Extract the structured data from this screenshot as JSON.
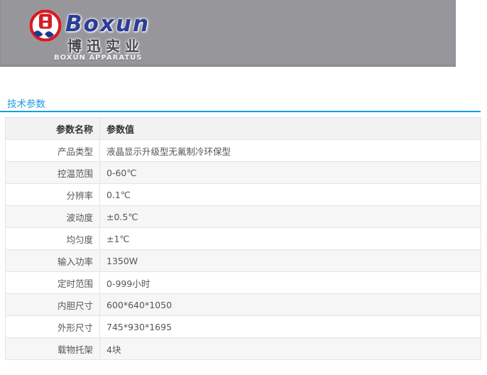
{
  "header": {
    "brand": "Boxun",
    "brand_cn": "博迅实业",
    "brand_en": "BOXUN APPARATUS"
  },
  "colors": {
    "banner_bg": "#97979b",
    "brand_blue": "#2b3e98",
    "logo_red": "#d21f26",
    "logo_navy": "#1e3a8f",
    "accent": "#1b9be1"
  },
  "section": {
    "title": "技术参数"
  },
  "table": {
    "headers": [
      "参数名称",
      "参数值"
    ],
    "rows": [
      {
        "name": "产品类型",
        "value": "液晶显示升级型无氟制冷环保型"
      },
      {
        "name": "控温范围",
        "value": "0-60℃"
      },
      {
        "name": "分辨率",
        "value": "0.1℃"
      },
      {
        "name": "波动度",
        "value": "±0.5℃"
      },
      {
        "name": "均匀度",
        "value": "±1℃"
      },
      {
        "name": "输入功率",
        "value": "1350W"
      },
      {
        "name": "定时范围",
        "value": "0-999小时"
      },
      {
        "name": "内胆尺寸",
        "value": "600*640*1050"
      },
      {
        "name": "外形尺寸",
        "value": "745*930*1695"
      },
      {
        "name": "载物托架",
        "value": "4块"
      }
    ]
  }
}
